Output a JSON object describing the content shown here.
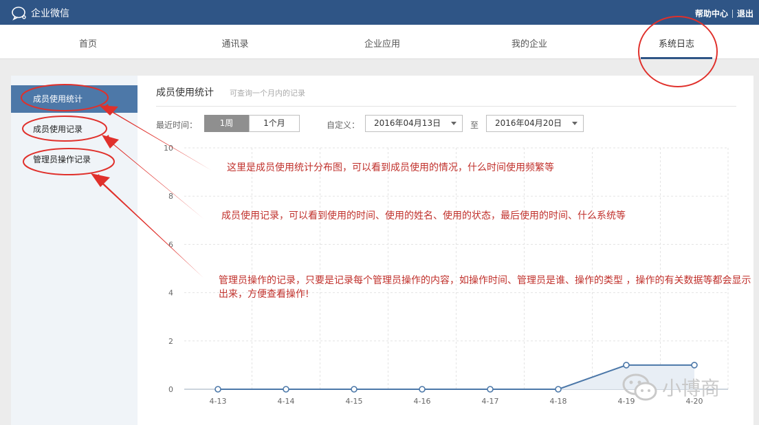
{
  "topbar": {
    "logo_text": "企业微信",
    "help_link": "帮助中心",
    "logout_link": "退出"
  },
  "nav": {
    "items": [
      {
        "label": "首页"
      },
      {
        "label": "通讯录"
      },
      {
        "label": "企业应用"
      },
      {
        "label": "我的企业"
      },
      {
        "label": "系统日志",
        "active": true
      }
    ]
  },
  "sidebar": {
    "items": [
      {
        "label": "成员使用统计",
        "active": true
      },
      {
        "label": "成员使用记录"
      },
      {
        "label": "管理员操作记录"
      }
    ]
  },
  "main": {
    "title": "成员使用统计",
    "subtitle": "可查询一个月内的记录",
    "filter_label": "最近时间：",
    "range_options": [
      "1周",
      "1个月"
    ],
    "selected_range": "1周",
    "custom_label": "自定义：",
    "date_from": "2016年04月13日",
    "to_label": "至",
    "date_to": "2016年04月20日"
  },
  "chart_data": {
    "type": "area",
    "x": [
      "4-13",
      "4-14",
      "4-15",
      "4-16",
      "4-17",
      "4-18",
      "4-19",
      "4-20"
    ],
    "series": [
      {
        "values": [
          0,
          0,
          0,
          0,
          0,
          0,
          1,
          1
        ]
      }
    ],
    "ylim": [
      0,
      10
    ],
    "yticks": [
      0,
      2,
      4,
      6,
      8,
      10
    ],
    "grid": true,
    "title": "",
    "xlabel": "",
    "ylabel": ""
  },
  "annotations": {
    "note_stats": "这里是成员使用统计分布图，可以看到成员使用的情况，什么时间使用频繁等",
    "note_records": "成员使用记录，可以看到使用的时间、使用的姓名、使用的状态，最后使用的时间、什么系统等",
    "note_admin": "管理员操作的记录，只要是记录每个管理员操作的内容，如操作时间、管理员是谁、操作的类型 ，操作的有关数据等都会显示出来，方便查看操作!"
  },
  "watermark": {
    "text": "小博商"
  },
  "colors": {
    "header_blue": "#2f5586",
    "sidebar_active": "#4d78a8",
    "series_line": "#4b77a8",
    "annotation_red": "#e0302b"
  }
}
